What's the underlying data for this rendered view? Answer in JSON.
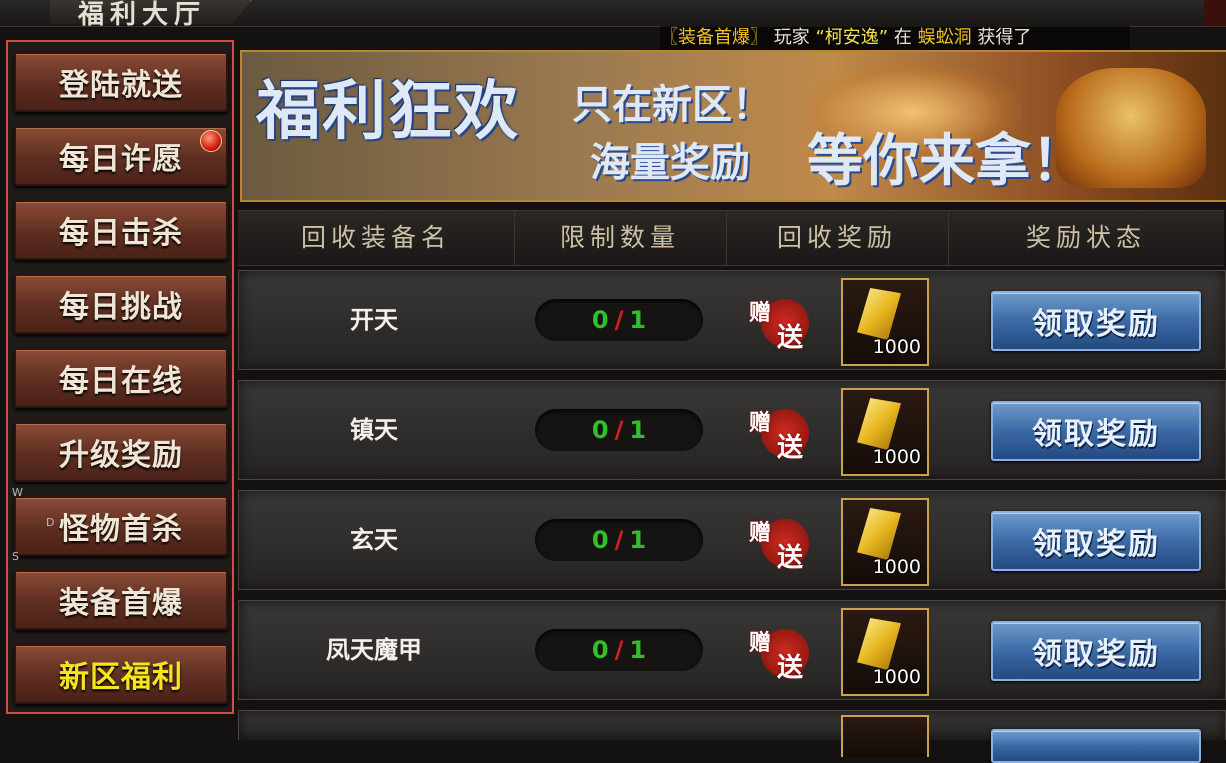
{
  "window": {
    "title": "福利大厅"
  },
  "ticker": {
    "tag": "〖装备首爆〗",
    "player_prefix": "玩家",
    "player": "“柯安逸”",
    "in": "在",
    "place": "蜈蚣洞",
    "suffix": "获得了"
  },
  "sidebar": {
    "items": [
      {
        "label": "登陆就送"
      },
      {
        "label": "每日许愿"
      },
      {
        "label": "每日击杀"
      },
      {
        "label": "每日挑战"
      },
      {
        "label": "每日在线"
      },
      {
        "label": "升级奖励"
      },
      {
        "label": "怪物首杀"
      },
      {
        "label": "装备首爆"
      },
      {
        "label": "新区福利"
      }
    ],
    "active": "新区福利",
    "marks": {
      "w": "W",
      "d": "D",
      "s": "S"
    }
  },
  "banner": {
    "line1": "福利狂欢",
    "line2": "只在新区！",
    "line3": "海量奖励",
    "line4": "等你来拿！"
  },
  "table": {
    "headers": [
      "回收装备名",
      "限制数量",
      "回收奖励",
      "奖励状态"
    ],
    "rows": [
      {
        "name": "开天",
        "current": "0",
        "slash": "/",
        "limit": "1",
        "gift1": "赠",
        "gift2": "送",
        "reward_qty": "1000",
        "button": "领取奖励"
      },
      {
        "name": "镇天",
        "current": "0",
        "slash": "/",
        "limit": "1",
        "gift1": "赠",
        "gift2": "送",
        "reward_qty": "1000",
        "button": "领取奖励"
      },
      {
        "name": "玄天",
        "current": "0",
        "slash": "/",
        "limit": "1",
        "gift1": "赠",
        "gift2": "送",
        "reward_qty": "1000",
        "button": "领取奖励"
      },
      {
        "name": "凤天魔甲",
        "current": "0",
        "slash": "/",
        "limit": "1",
        "gift1": "赠",
        "gift2": "送",
        "reward_qty": "1000",
        "button": "领取奖励"
      }
    ]
  },
  "colors": {
    "active_menu": "#f5e51c",
    "count_green": "#2fc02a",
    "slash_red": "#d42020",
    "claim_blue": "#3a6aa6"
  }
}
